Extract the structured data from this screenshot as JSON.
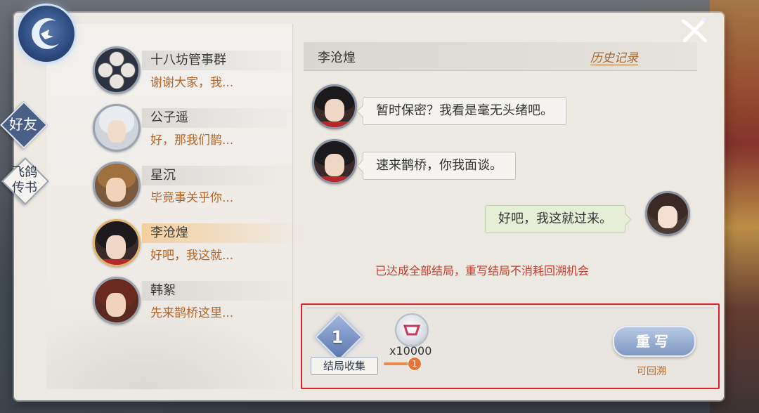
{
  "side_tabs": [
    {
      "label": "好友",
      "active": true
    },
    {
      "label": "飞鸽\n传书",
      "active": false
    }
  ],
  "contacts": [
    {
      "name": "十八坊管事群",
      "preview": "谢谢大家，我...",
      "selected": false
    },
    {
      "name": "公子遥",
      "preview": "好，那我们鹊...",
      "selected": false
    },
    {
      "name": "星沉",
      "preview": "毕竟事关乎你...",
      "selected": false
    },
    {
      "name": "李沧煌",
      "preview": "好吧，我这就...",
      "selected": true
    },
    {
      "name": "韩絮",
      "preview": "先来鹊桥这里...",
      "selected": false
    }
  ],
  "chat": {
    "title": "李沧煌",
    "history_link": "历史记录",
    "messages": [
      {
        "from": "other",
        "text": "暂时保密？我看是毫无头绪吧。"
      },
      {
        "from": "other",
        "text": "速来鹊桥，你我面谈。"
      },
      {
        "from": "me",
        "text": "好吧，我这就过来。"
      }
    ],
    "notice": "已达成全部结局，重写结局不消耗回溯机会"
  },
  "bottom": {
    "collection_count": "1",
    "collection_label": "结局收集",
    "item_count": "x10000",
    "item_badge": "1",
    "rewrite_button": "重写",
    "rewrite_sub": "可回溯"
  },
  "colors": {
    "accent_orange": "#b5652a",
    "notice_red": "#c23b2c",
    "highlight_border": "#e01f2a",
    "button_blue": "#7f98c2"
  },
  "icons": {
    "logo": "crescent-bird-icon",
    "close": "close-x-icon",
    "item": "rewind-token-icon"
  }
}
